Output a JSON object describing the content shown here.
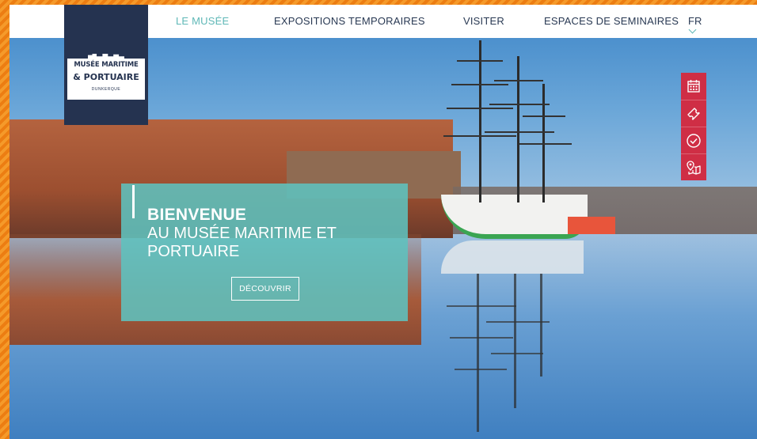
{
  "nav": {
    "items": [
      {
        "label": "LE MUSÉE",
        "active": true
      },
      {
        "label": "EXPOSITIONS TEMPORAIRES",
        "active": false
      },
      {
        "label": "VISITER",
        "active": false
      },
      {
        "label": "ESPACES DE SEMINAIRES",
        "active": false
      }
    ],
    "language": "FR"
  },
  "logo": {
    "line1": "MUSÉE MARITIME",
    "line2": "& PORTUAIRE",
    "line3": "DUNKERQUE"
  },
  "tools": [
    "calendar-icon",
    "ticket-icon",
    "check-circle-icon",
    "map-pin-icon"
  ],
  "hero": {
    "title": "BIENVENUE",
    "subtitle": "AU MUSÉE MARITIME ET PORTUAIRE",
    "button": "DÉCOUVRIR"
  },
  "colors": {
    "nav_active": "#5fb8b7",
    "nav_text": "#2a3a54",
    "logo_bg": "#253350",
    "tools_bg": "#cf2e45",
    "panel_bg": "#5ec1be",
    "frame": "#f28a1e"
  }
}
